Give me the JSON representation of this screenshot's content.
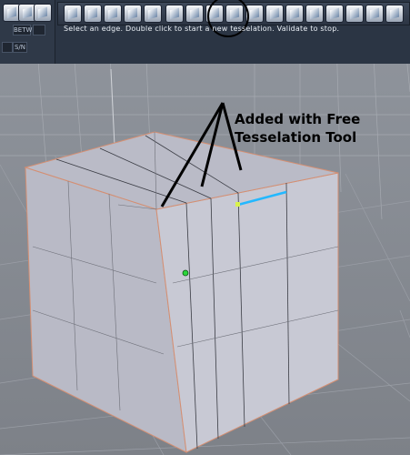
{
  "toolbar": {
    "hint_text": "Select an edge. Double click to start a new tesselation. Validate to stop.",
    "left_buttons": [
      "BETW",
      "",
      "",
      "S/N"
    ],
    "tools": [
      {
        "icon": "select-icon"
      },
      {
        "icon": "cube-icon"
      },
      {
        "icon": "extrude-icon"
      },
      {
        "icon": "bevel-icon"
      },
      {
        "icon": "split-icon"
      },
      {
        "icon": "free-tesselation-icon",
        "highlighted": true
      },
      {
        "icon": "tesselate-icon"
      },
      {
        "icon": "slice-icon"
      },
      {
        "icon": "weld-icon"
      },
      {
        "icon": "smooth-icon"
      },
      {
        "icon": "sculpt-icon"
      },
      {
        "icon": "knife-icon"
      },
      {
        "icon": "magnet-icon"
      },
      {
        "icon": "paint-icon"
      },
      {
        "icon": "select-edges-icon"
      },
      {
        "icon": "add-point-icon"
      },
      {
        "icon": "zoom-icon"
      }
    ]
  },
  "annotation": {
    "line1": "Added with Free",
    "line2": "Tesselation Tool"
  }
}
